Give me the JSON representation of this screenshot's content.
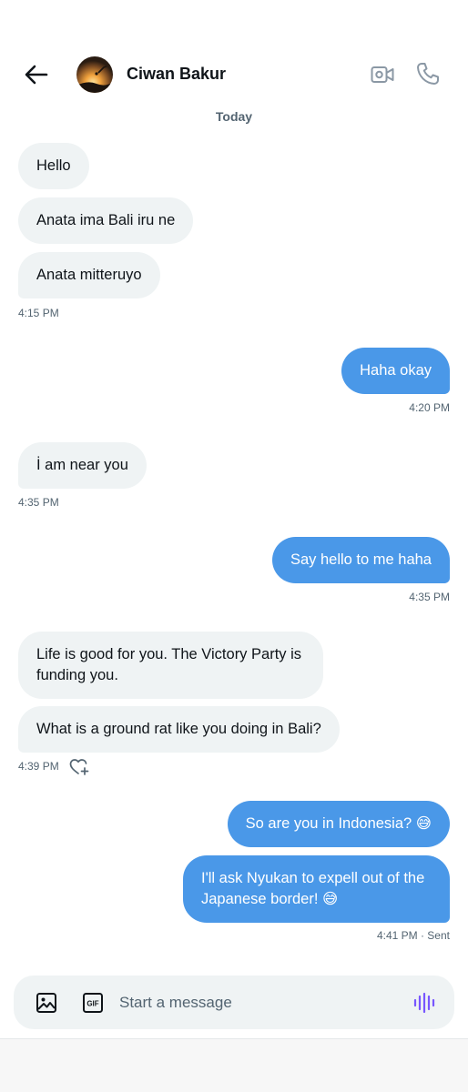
{
  "header": {
    "contact_name": "Ciwan Bakur",
    "icons": [
      "arrow-left-icon",
      "video-camera-icon",
      "phone-icon"
    ]
  },
  "day_separator": "Today",
  "messages": [
    {
      "side": "in",
      "text": "Hello"
    },
    {
      "side": "in",
      "text": "Anata ima Bali iru ne"
    },
    {
      "side": "in",
      "text": "Anata mitteruyo",
      "time": "4:15 PM"
    },
    {
      "side": "out",
      "text": "Haha okay",
      "time": "4:20 PM"
    },
    {
      "side": "in",
      "text": "İ am near you",
      "time": "4:35 PM"
    },
    {
      "side": "out",
      "text": "Say hello to me haha",
      "time": "4:35 PM"
    },
    {
      "side": "in",
      "text": "Life is good for you. The Victory Party is funding you."
    },
    {
      "side": "in",
      "text": "What is a ground rat like you doing in Bali?",
      "time": "4:39 PM"
    },
    {
      "side": "out",
      "text": "So are you in Indonesia? 😅"
    },
    {
      "side": "out",
      "text": "I'll ask Nyukan to expell out of the Japanese border! 😅",
      "time": "4:41 PM · Sent"
    }
  ],
  "composer": {
    "placeholder": "Start a message",
    "value": "",
    "icons": [
      "image-icon",
      "gif-icon",
      "voice-wave-icon"
    ]
  },
  "colors": {
    "outgoing_bubble": "#4a98e8",
    "incoming_bubble": "#eff3f4",
    "voice_accent": "#7856ff",
    "secondary_text": "#536471"
  }
}
